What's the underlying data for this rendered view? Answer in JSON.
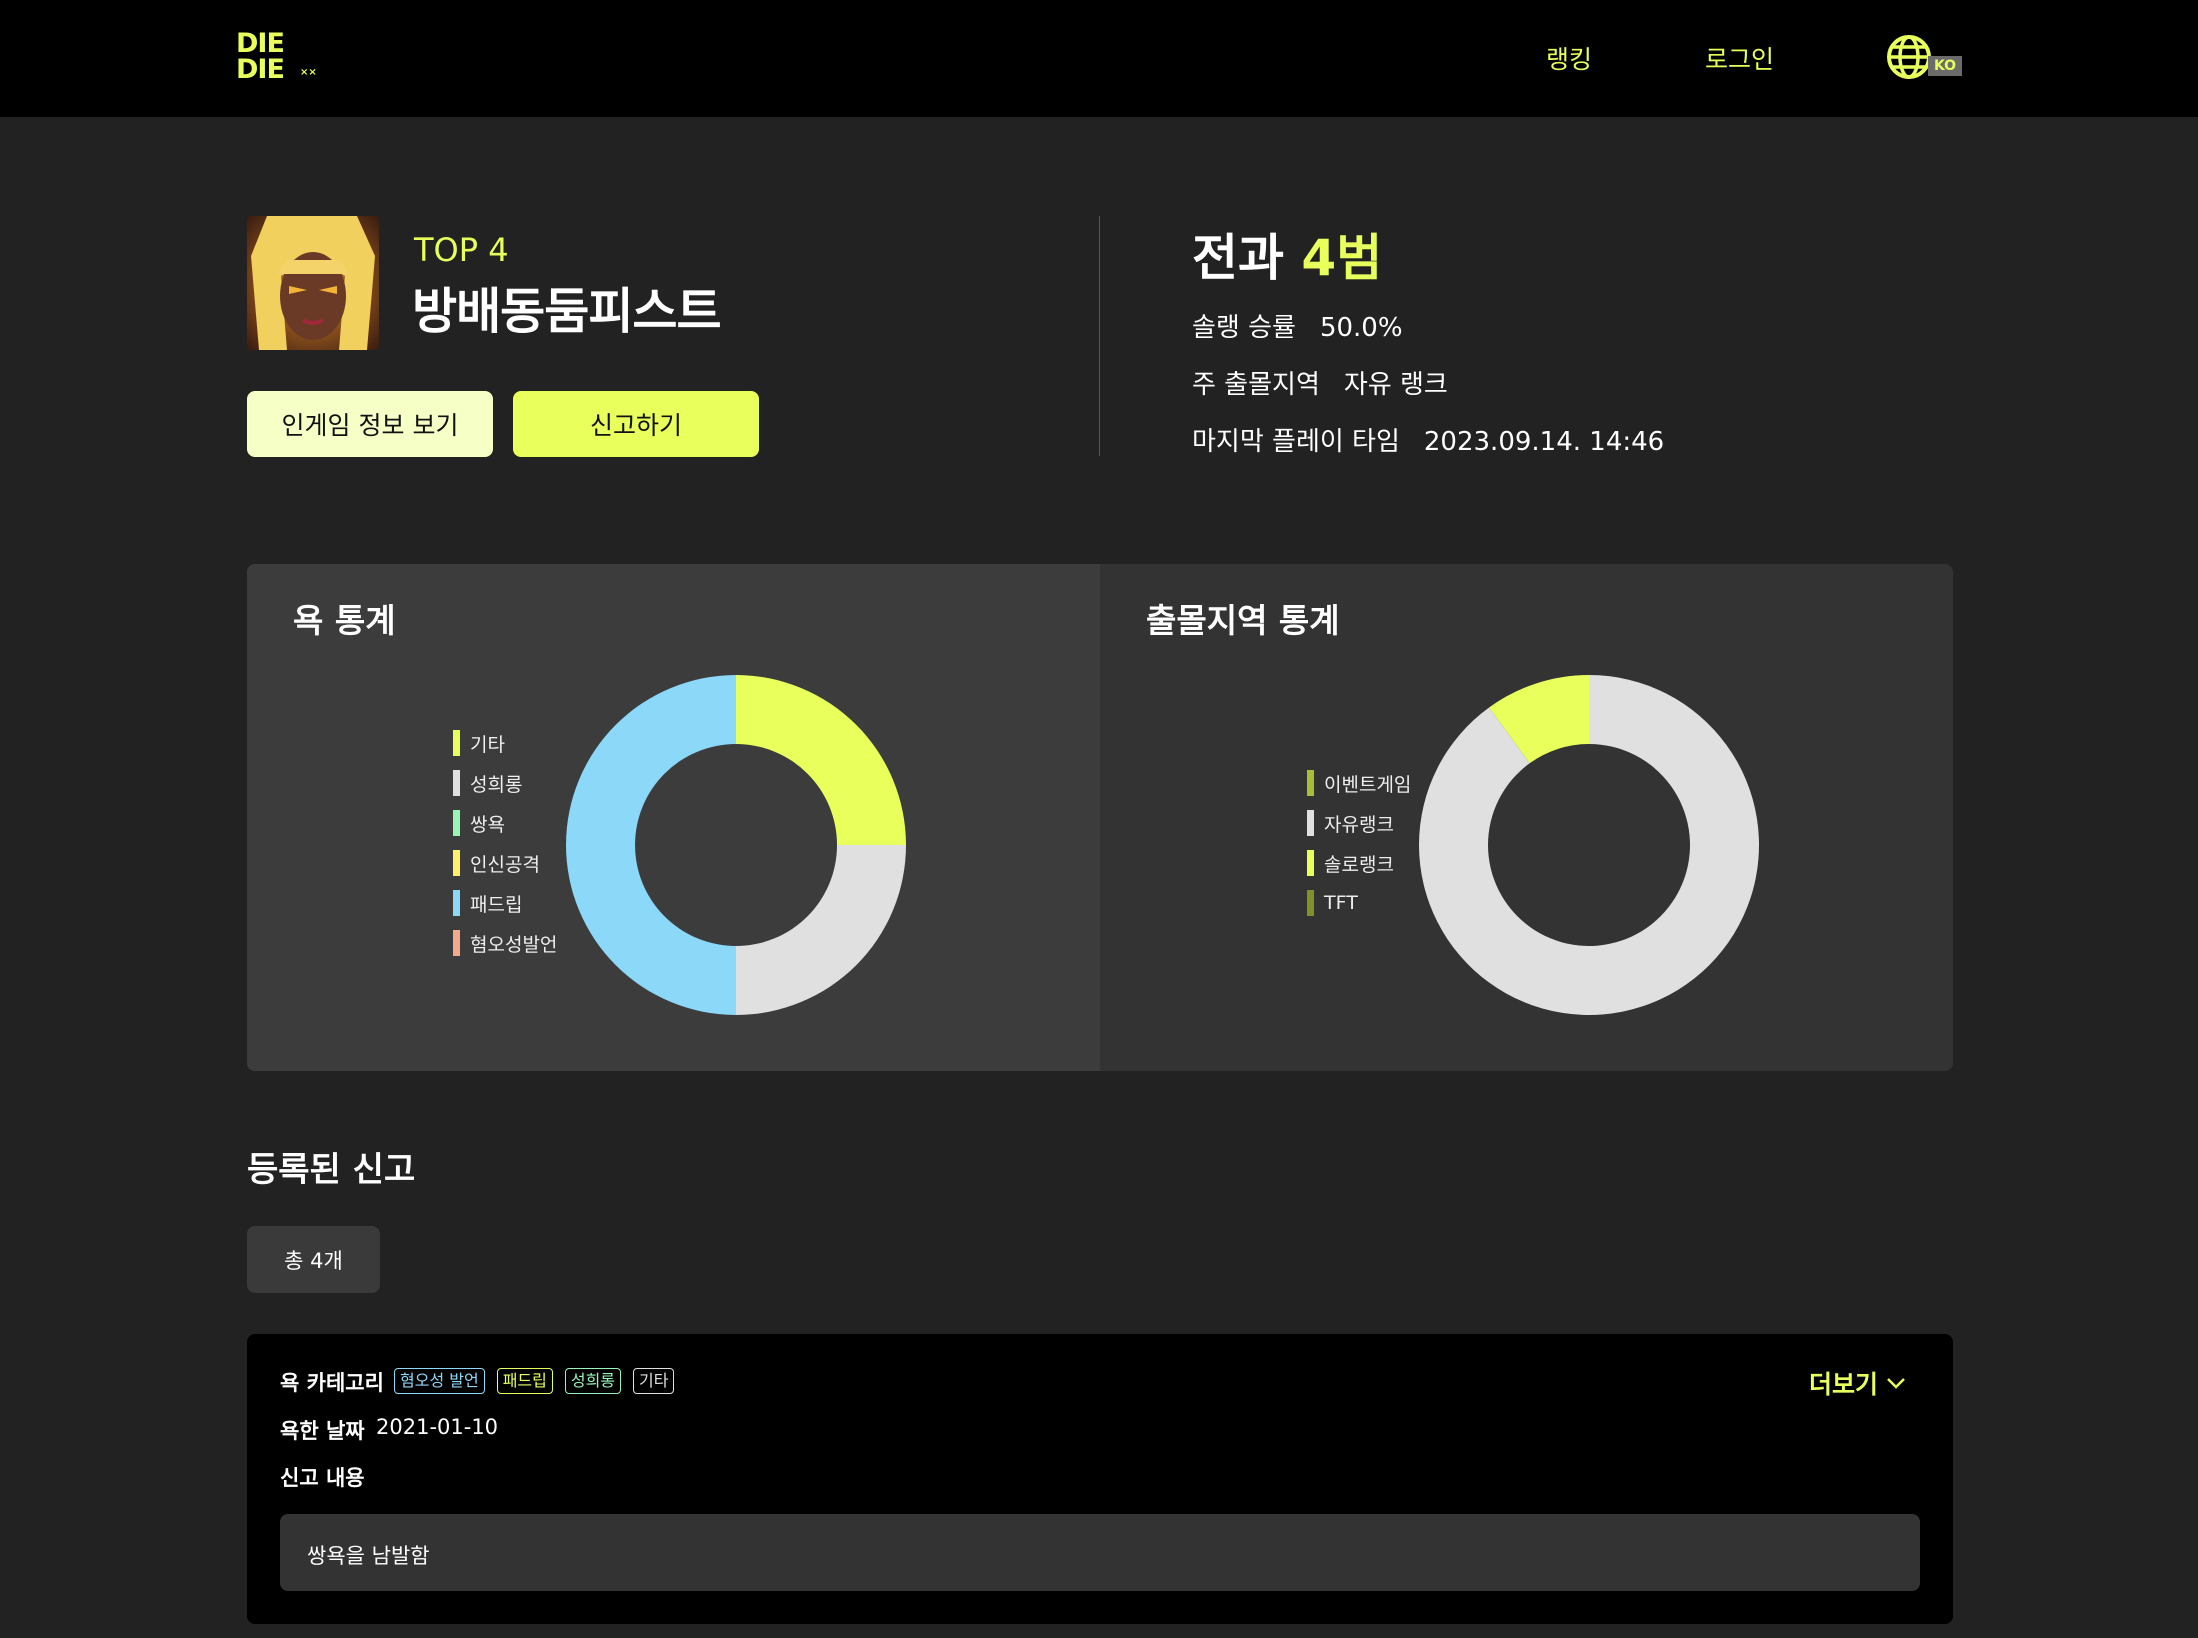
{
  "header": {
    "logo_line1": "DIE",
    "logo_line2": "DIE",
    "logo_mark": "××",
    "nav": [
      {
        "label": "랭킹"
      },
      {
        "label": "로그인"
      }
    ],
    "lang_icon": "globe-icon",
    "lang_code": "KO"
  },
  "profile": {
    "rank": "TOP 4",
    "nickname": "방배동둠피스트",
    "avatar_icon": "champion-portrait",
    "buttons": {
      "ingame_info": "인게임 정보 보기",
      "report": "신고하기"
    }
  },
  "summary": {
    "record_label": "전과",
    "record_value": "4범",
    "solo_winrate_label": "솔랭 승률",
    "solo_winrate_value": "50.0%",
    "main_area_label": "주 출몰지역",
    "main_area_value": "자유 랭크",
    "last_play_label": "마지막 플레이 타임",
    "last_play_value": "2023.09.14. 14:46"
  },
  "charts": {
    "abuse_title": "욕 통계",
    "area_title": "출몰지역 통계"
  },
  "chart_data": [
    {
      "type": "pie",
      "title": "욕 통계",
      "donut": true,
      "legend_position": "left",
      "series": [
        {
          "name": "기타",
          "value": 1,
          "color": "#e8ff5c"
        },
        {
          "name": "성희롱",
          "value": 1,
          "color": "#e0e0e0"
        },
        {
          "name": "쌍욕",
          "value": 0,
          "color": "#98f5b5"
        },
        {
          "name": "인신공격",
          "value": 0,
          "color": "#fff06b"
        },
        {
          "name": "패드립",
          "value": 2,
          "color": "#8cd8f9"
        },
        {
          "name": "혐오성발언",
          "value": 0,
          "color": "#f3a98c"
        }
      ]
    },
    {
      "type": "pie",
      "title": "출몰지역 통계",
      "donut": true,
      "legend_position": "left",
      "series": [
        {
          "name": "이벤트게임",
          "value": 0,
          "color": "#a9bd3b"
        },
        {
          "name": "자유랭크",
          "value": 9,
          "color": "#e0e0e0"
        },
        {
          "name": "솔로랭크",
          "value": 1,
          "color": "#e8ff5c"
        },
        {
          "name": "TFT",
          "value": 0,
          "color": "#7f9129"
        }
      ]
    }
  ],
  "reports": {
    "title": "등록된 신고",
    "count_label": "총 4개",
    "items": [
      {
        "category_label": "욕 카테고리",
        "tags": [
          {
            "label": "혐오성 발언",
            "color": "#8cd8f9"
          },
          {
            "label": "패드립",
            "color": "#e8ff5c"
          },
          {
            "label": "성희롱",
            "color": "#98f5b5"
          },
          {
            "label": "기타",
            "color": "#e0e0e0"
          }
        ],
        "date_label": "욕한 날짜",
        "date_value": "2021-01-10",
        "content_label": "신고 내용",
        "content": "쌍욕을 남발함",
        "more_label": "더보기",
        "more_icon": "chevron-down-icon"
      }
    ]
  }
}
